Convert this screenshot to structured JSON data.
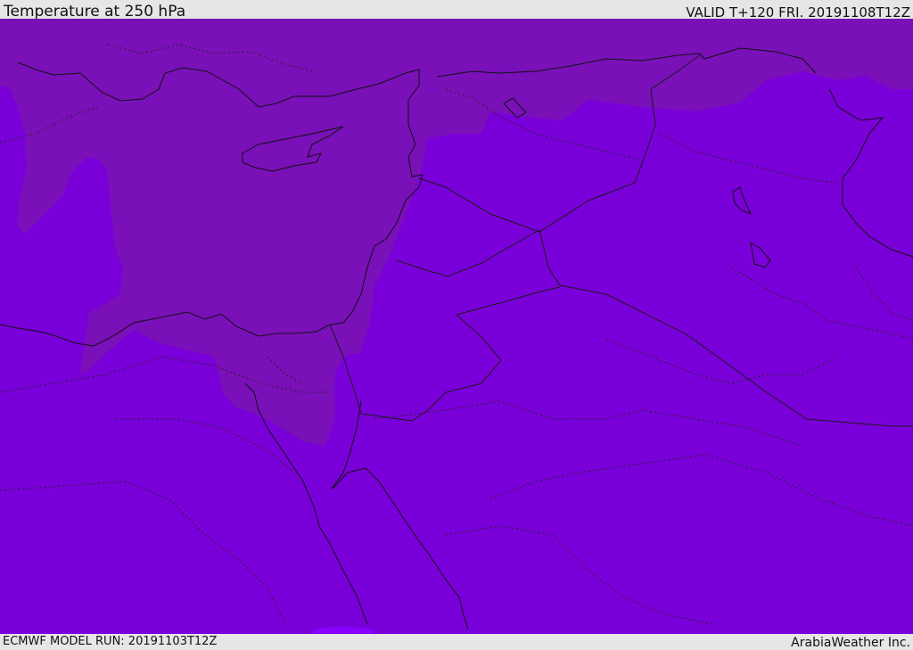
{
  "header": {
    "title": "Temperature at 250 hPa",
    "valid_text": "VALID T+120 FRI. 20191108T12Z"
  },
  "footer": {
    "model_run": "ECMWF MODEL RUN: 20191103T12Z",
    "credit": "ArabiaWeather Inc."
  },
  "map": {
    "colors": {
      "background_band": "#7a00d9",
      "cold_band": "#7a10b8",
      "warm_spot": "#8800ff",
      "coastline": "#111111",
      "border": "#1a1a1a"
    }
  }
}
